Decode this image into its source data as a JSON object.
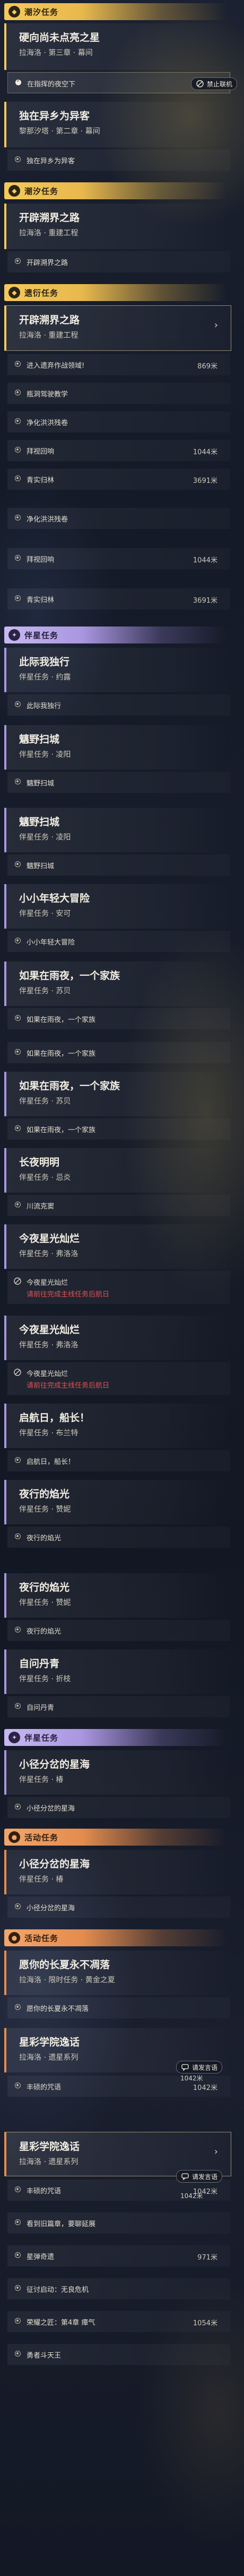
{
  "headers": {
    "h1": "潮汐任务",
    "h2": "潮汐任务",
    "h3": "遗衍任务",
    "h4": "伴星任务",
    "h5": "伴星任务",
    "h6": "活动任务",
    "h7": "活动任务"
  },
  "quests": {
    "q1": {
      "title": "硬向尚未点亮之星",
      "sub": "拉海洛 · 第三章 · 幕间"
    },
    "q2": {
      "title": "独在异乡为异客",
      "sub": "黎那汐塔 · 第二章 · 幕间"
    },
    "q3": {
      "title": "开辟溯界之路",
      "sub": "拉海洛 · 重建工程"
    },
    "q4": {
      "title": "开辟溯界之路",
      "sub": "拉海洛 · 重建工程"
    },
    "q5": {
      "title": "此际我独行",
      "sub": "伴星任务 · 约露"
    },
    "q6": {
      "title": "魑野扫城",
      "sub": "伴星任务 · 凌阳"
    },
    "q7": {
      "title": "魑野扫城",
      "sub": "伴星任务 · 凌阳"
    },
    "q8": {
      "title": "小小年轻大冒险",
      "sub": "伴星任务 · 安可"
    },
    "q9": {
      "title": "如果在雨夜，一个家族",
      "sub": "伴星任务 · 苏贝"
    },
    "q10": {
      "title": "如果在雨夜，一个家族",
      "sub": "伴星任务 · 苏贝"
    },
    "q11": {
      "title": "长夜明明",
      "sub": "伴星任务 · 忌炎"
    },
    "q12": {
      "title": "今夜星光灿烂",
      "sub": "伴星任务 · 弗洛洛"
    },
    "q13": {
      "title": "今夜星光灿烂",
      "sub": "伴星任务 · 弗洛洛"
    },
    "q14": {
      "title": "启航日，船长！",
      "sub": "伴星任务 · 布兰特"
    },
    "q15": {
      "title": "夜行的焰光",
      "sub": "伴星任务 · 赞妮"
    },
    "q16": {
      "title": "夜行的焰光",
      "sub": "伴星任务 · 赞妮"
    },
    "q17": {
      "title": "自问丹青",
      "sub": "伴星任务 · 折枝"
    },
    "q18": {
      "title": "小径分岔的星海",
      "sub": "伴星任务 · 椿"
    },
    "q19": {
      "title": "小径分岔的星海",
      "sub": "伴星任务 · 椿"
    },
    "q20": {
      "title": "愿你的长夏永不凋落",
      "sub": "拉海洛 · 限时任务 · 黄金之夏"
    },
    "q21": {
      "title": "星彩学院逸话",
      "sub": "拉海洛 · 遗星系列"
    },
    "q22": {
      "title": "星彩学院逸话",
      "sub": "拉海洛 · 遗星系列"
    }
  },
  "steps": {
    "s1": "在指挥的夜空下",
    "s2": "独在异乡为异客",
    "s3": "开辟溯界之路",
    "s4": "进入遗弃作战领域!",
    "s5": "瓶洞驾驶教学",
    "s6": "净化洪洪残卷",
    "s7": "拜视回响",
    "s8": "青实归林",
    "s9": "净化洪洪残卷",
    "s10": "拜视回响",
    "s11": "青实归林",
    "s12": "此际我独行",
    "s13": "魑野扫城",
    "s14": "魑野扫城",
    "s15": "小小年轻大冒险",
    "s16": "如果在雨夜，一个家族",
    "s17": "如果在雨夜，一个家族",
    "s18": "如果在雨夜，一个家族",
    "s19": "川流克窦",
    "s20": "今夜星光灿烂",
    "s20w": "请前往完成主线任务后航日",
    "s21": "今夜星光灿烂",
    "s21w": "请前往完成主线任务后航日",
    "s22": "启航日，船长！",
    "s23": "夜行的焰光",
    "s24": "夜行的焰光",
    "s25": "自问丹青",
    "s26": "小径分岔的星海",
    "s27": "小径分岔的星海",
    "s28": "愿你的长夏永不凋落",
    "s29": "丰硕的咒语",
    "s30": "丰硕的咒语",
    "s31": "看到旧篇章，要聊延展",
    "s32": "星弹奇遗",
    "s33": "征讨启动：无良危机",
    "s34": "荣耀之匠：第4章 瘴气",
    "s35": "勇者斗天王"
  },
  "distances": {
    "d4": "869米",
    "d7": "1044米",
    "d8": "3691米",
    "d10": "1044米",
    "d11": "3691米",
    "d29": "1042米",
    "d30": "1042米",
    "d32": "971米",
    "d34": "1054米",
    "fd1": "1042米",
    "fd2": "1042米"
  },
  "float": {
    "disconnect": "禁止联机",
    "speak1": "请发言语",
    "speak2": "请发言语",
    "activity_label": "活动任务"
  },
  "colors": {
    "tide": "#f4c95a",
    "companion": "#a996e0",
    "event": "#e48c4e",
    "warning": "#e05353"
  }
}
